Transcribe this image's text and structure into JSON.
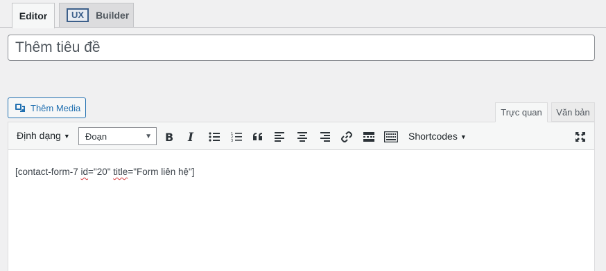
{
  "top_tabs": {
    "editor_label": "Editor",
    "ux_badge": "UX",
    "builder_label": "Builder"
  },
  "title": {
    "placeholder": "Thêm tiêu đề"
  },
  "media": {
    "button_label": "Thêm Media"
  },
  "mode_tabs": {
    "visual_label": "Trực quan",
    "text_label": "Văn bản"
  },
  "toolbar": {
    "format_label": "Định dạng",
    "paragraph_select": "Đoạn",
    "shortcodes_label": "Shortcodes",
    "icons": [
      "bold-icon",
      "italic-icon",
      "bullet-list-icon",
      "numbered-list-icon",
      "blockquote-icon",
      "align-left-icon",
      "align-center-icon",
      "align-right-icon",
      "link-icon",
      "read-more-icon",
      "toolbar-toggle-icon",
      "fullscreen-icon"
    ]
  },
  "content": {
    "prefix": "[contact-form-7 ",
    "id_attr": "id",
    "id_value": "=\"20\" ",
    "title_attr": "title",
    "title_value": "=\"Form liên hệ\"]"
  },
  "colors": {
    "accent": "#2271b1",
    "background": "#f0f0f1",
    "spellcheck": "#d63638"
  }
}
